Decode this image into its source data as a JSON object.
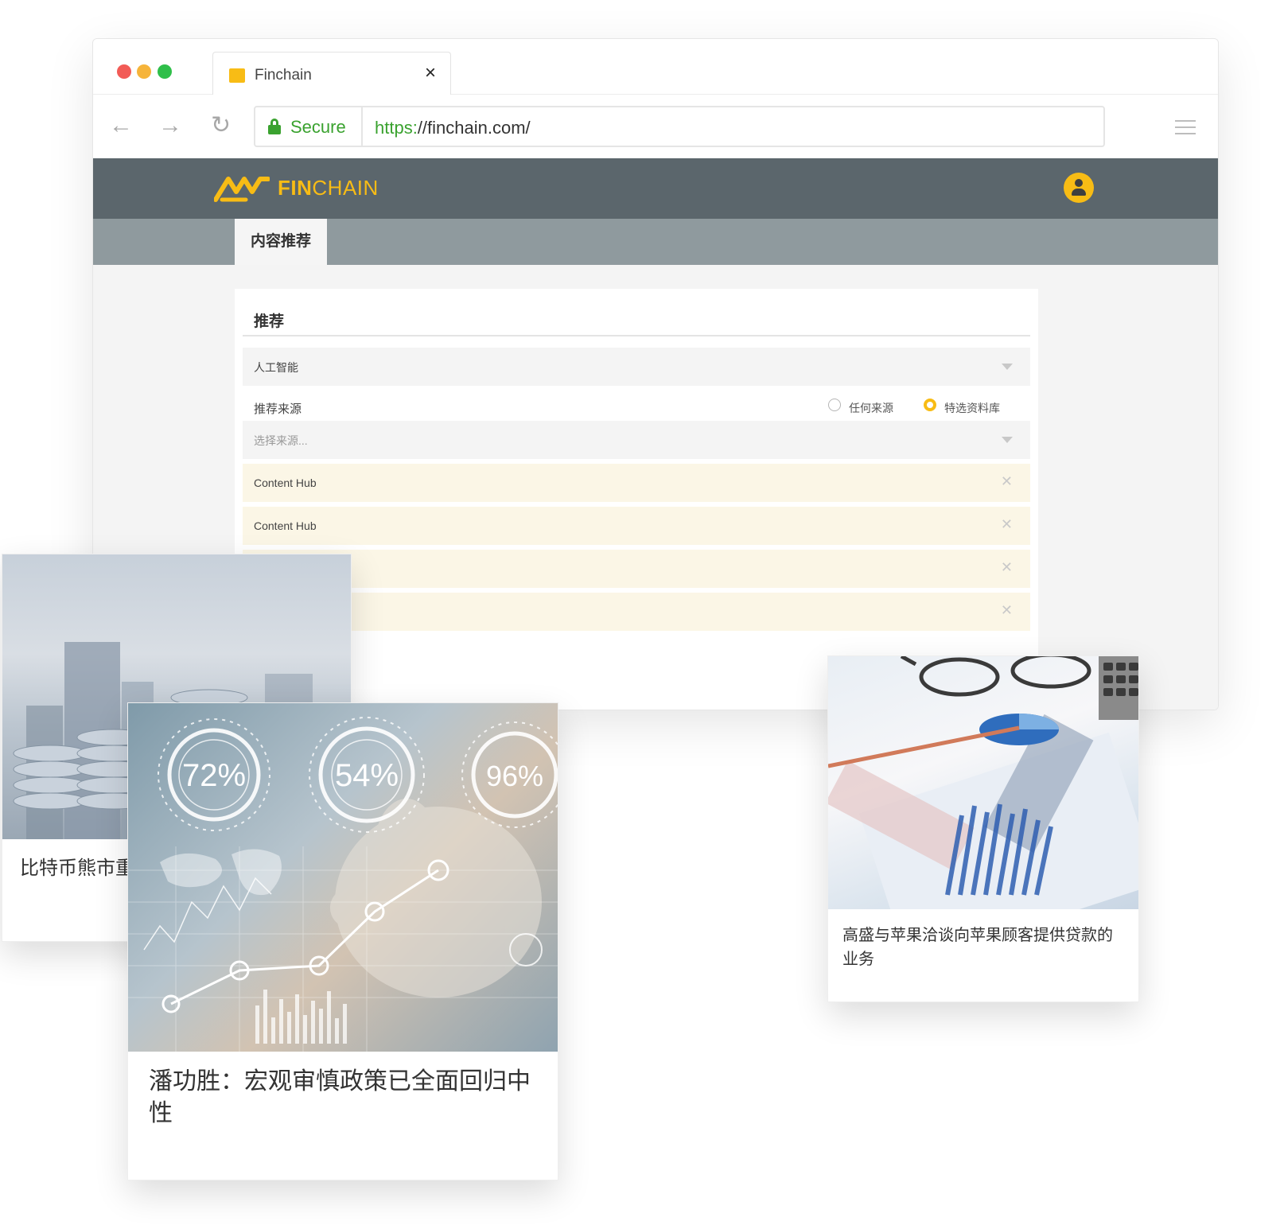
{
  "browser": {
    "tab_title": "Finchain",
    "tab_close": "×",
    "secure_label": "Secure",
    "url_scheme": "https:",
    "url_rest": "//finchain.com/"
  },
  "app": {
    "logo_bold": "FIN",
    "logo_light": "CHAIN",
    "subnav_tab": "内容推荐",
    "brand_color": "#f8bc15",
    "header_color": "#5b666c"
  },
  "panel": {
    "title": "推荐",
    "topic_select_value": "人工智能",
    "source_label": "推荐来源",
    "radio_any": "任何来源",
    "radio_featured": "特选资料库",
    "radio_selected": "特选资料库",
    "source_select_placeholder": "选择来源...",
    "chips": [
      "Content Hub",
      "Content Hub",
      "",
      ""
    ]
  },
  "cards": [
    {
      "caption": "比特币熊市重"
    },
    {
      "caption": "潘功胜：宏观审慎政策已全面回归中性"
    },
    {
      "caption": "高盛与苹果洽谈向苹果顾客提供贷款的业务"
    }
  ],
  "card_image_overlays": [
    "72%",
    "54%",
    "96%"
  ]
}
